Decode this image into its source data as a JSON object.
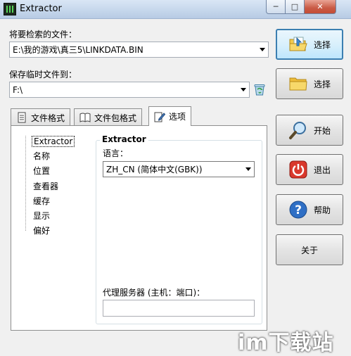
{
  "window": {
    "title": "Extractor",
    "controls": {
      "minimize": "─",
      "maximize": "□",
      "close": "✕"
    }
  },
  "search_file": {
    "label": "将要检索的文件：",
    "value": "E:\\我的游戏\\真三5\\LINKDATA.BIN"
  },
  "temp_folder": {
    "label": "保存临时文件到：",
    "value": "F:\\"
  },
  "side_buttons": {
    "select1": "选择",
    "select2": "选择",
    "start": "开始",
    "exit": "退出",
    "help": "帮助",
    "about": "关于"
  },
  "tabs": [
    {
      "label": "文件格式"
    },
    {
      "label": "文件包格式"
    },
    {
      "label": "选项"
    }
  ],
  "tree": [
    "Extractor",
    "名称",
    "位置",
    "查看器",
    "缓存",
    "显示",
    "偏好"
  ],
  "options": {
    "group_title": "Extractor",
    "language_label": "语言：",
    "language_value": "ZH_CN (简体中文(GBK))",
    "proxy_label": "代理服务器 (主机：端口)：",
    "proxy_value": ""
  },
  "watermark": "im下载站",
  "colors": {
    "titlebar": "#c6d7ec",
    "close_button": "#c95a45",
    "window_bg": "#f0f0f0",
    "active_button_border": "#3c7fb1"
  }
}
